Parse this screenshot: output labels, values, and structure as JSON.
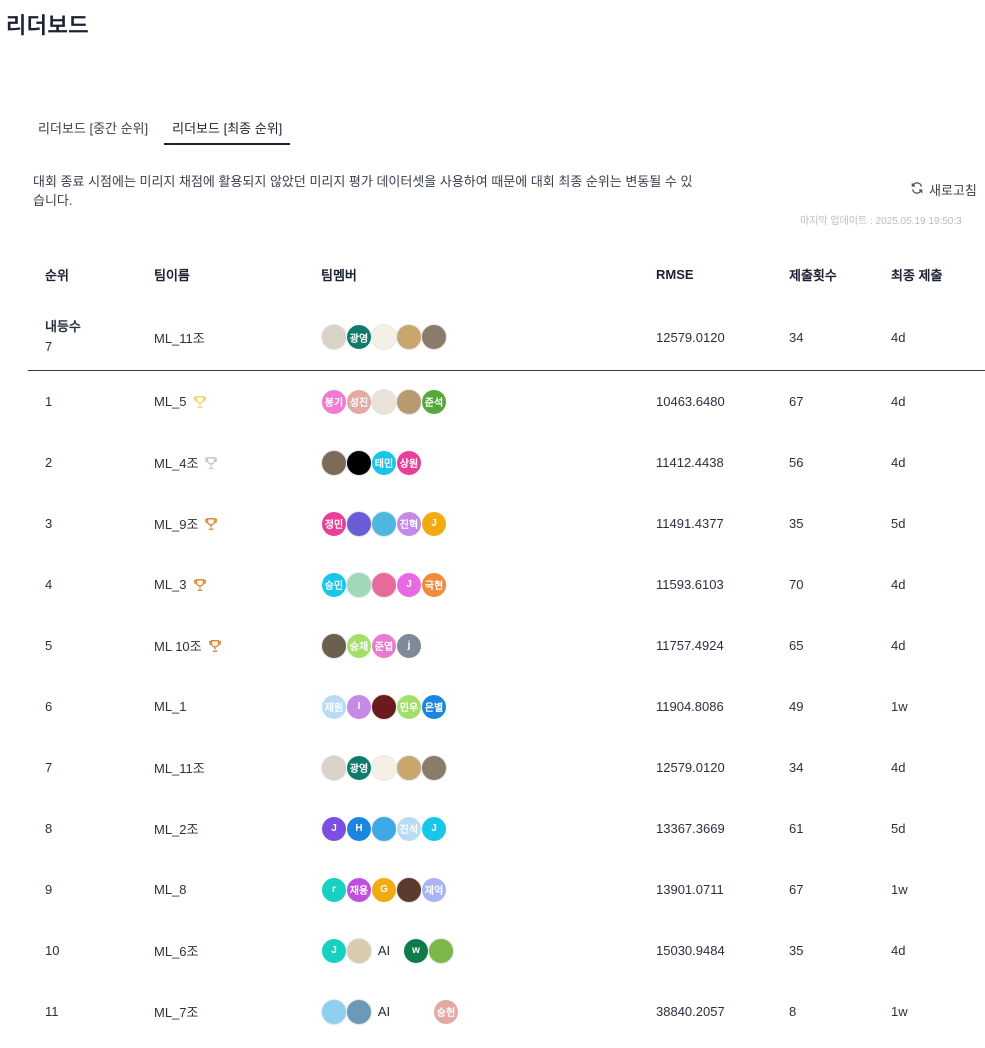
{
  "page": {
    "title": "리더보드"
  },
  "tabs": [
    {
      "label": "리더보드 [중간 순위]",
      "active": false
    },
    {
      "label": "리더보드 [최종 순위]",
      "active": true
    }
  ],
  "notice": "대회 종료 시점에는 미리지 채점에 활용되지 않았던 미리지 평가 데이터셋을 사용하여 때문에 대회 최종 순위는 변동될 수 있습니다.",
  "refresh": {
    "label": "새로고침",
    "icon": "refresh-icon"
  },
  "updated": "마지막 업데이트 : 2025.05.19 19:50:3",
  "columns": {
    "rank": "순위",
    "team": "팀이름",
    "members": "팀멤버",
    "rmse": "RMSE",
    "count": "제출횟수",
    "last": "최종 제출"
  },
  "my_team": {
    "label": "내등수",
    "rank": "7",
    "team": "ML_11조",
    "members": [
      {
        "type": "img",
        "color": "#d8d2c8"
      },
      {
        "type": "text",
        "label": "광영",
        "color": "#0f7b6c"
      },
      {
        "type": "img",
        "color": "#f4f0e6"
      },
      {
        "type": "img",
        "color": "#c9a66b"
      },
      {
        "type": "img",
        "color": "#8b7b6b"
      }
    ],
    "rmse": "12579.0120",
    "count": "34",
    "last": "4d"
  },
  "rows": [
    {
      "rank": "1",
      "team": "ML_5",
      "trophy": "gold",
      "trophy_color": "#f2d26b",
      "members": [
        {
          "type": "text",
          "label": "봉기",
          "color": "#f07bd0"
        },
        {
          "type": "text",
          "label": "성진",
          "color": "#e3a9a4"
        },
        {
          "type": "img",
          "color": "#e8e2d8"
        },
        {
          "type": "img",
          "color": "#b89a72"
        },
        {
          "type": "text",
          "label": "준석",
          "color": "#55a93a"
        }
      ],
      "rmse": "10463.6480",
      "count": "67",
      "last": "4d"
    },
    {
      "rank": "2",
      "team": "ML_4조",
      "trophy": "silver",
      "trophy_color": "#c3c7d0",
      "members": [
        {
          "type": "img",
          "color": "#7d6a58"
        },
        {
          "type": "img",
          "color": "#000000"
        },
        {
          "type": "text",
          "label": "태민",
          "color": "#18c6e8"
        },
        {
          "type": "text",
          "label": "상원",
          "color": "#e83f9a"
        }
      ],
      "rmse": "11412.4438",
      "count": "56",
      "last": "4d"
    },
    {
      "rank": "3",
      "team": "ML_9조",
      "trophy": "bronze",
      "trophy_color": "#e08a3c",
      "members": [
        {
          "type": "text",
          "label": "정민",
          "color": "#e83f9a"
        },
        {
          "type": "img",
          "color": "#6a5bd6"
        },
        {
          "type": "img",
          "color": "#4fb6e0"
        },
        {
          "type": "text",
          "label": "진혁",
          "color": "#c58ae8"
        },
        {
          "type": "text",
          "label": "J",
          "color": "#f2aa11"
        }
      ],
      "rmse": "11491.4377",
      "count": "35",
      "last": "5d"
    },
    {
      "rank": "4",
      "team": "ML_3",
      "trophy": "bronze",
      "trophy_color": "#e08a3c",
      "members": [
        {
          "type": "text",
          "label": "승민",
          "color": "#18c6e8"
        },
        {
          "type": "img",
          "color": "#9fd9b8"
        },
        {
          "type": "img",
          "color": "#e86a9a"
        },
        {
          "type": "text",
          "label": "J",
          "color": "#e86ae0"
        },
        {
          "type": "text",
          "label": "국현",
          "color": "#f08a3c"
        }
      ],
      "rmse": "11593.6103",
      "count": "70",
      "last": "4d"
    },
    {
      "rank": "5",
      "team": "ML 10조",
      "trophy": "bronze",
      "trophy_color": "#e08a3c",
      "members": [
        {
          "type": "img",
          "color": "#6b5f4e"
        },
        {
          "type": "text",
          "label": "승채",
          "color": "#a3e06b"
        },
        {
          "type": "text",
          "label": "준엽",
          "color": "#e87ad0"
        },
        {
          "type": "text",
          "label": "j",
          "color": "#7d8a99"
        }
      ],
      "rmse": "11757.4924",
      "count": "65",
      "last": "4d"
    },
    {
      "rank": "6",
      "team": "ML_1",
      "members": [
        {
          "type": "text",
          "label": "재원",
          "color": "#b8dcf4"
        },
        {
          "type": "text",
          "label": "I",
          "color": "#c58ae8"
        },
        {
          "type": "img",
          "color": "#6b1b1b"
        },
        {
          "type": "text",
          "label": "민우",
          "color": "#a3e06b"
        },
        {
          "type": "text",
          "label": "은별",
          "color": "#1a86e0"
        }
      ],
      "rmse": "11904.8086",
      "count": "49",
      "last": "1w"
    },
    {
      "rank": "7",
      "team": "ML_11조",
      "members": [
        {
          "type": "img",
          "color": "#d8d2c8"
        },
        {
          "type": "text",
          "label": "광영",
          "color": "#0f7b6c"
        },
        {
          "type": "img",
          "color": "#f4f0e6"
        },
        {
          "type": "img",
          "color": "#c9a66b"
        },
        {
          "type": "img",
          "color": "#8b7b6b"
        }
      ],
      "rmse": "12579.0120",
      "count": "34",
      "last": "4d"
    },
    {
      "rank": "8",
      "team": "ML_2조",
      "members": [
        {
          "type": "text",
          "label": "J",
          "color": "#7b4fe0"
        },
        {
          "type": "text",
          "label": "H",
          "color": "#1a86e0"
        },
        {
          "type": "img",
          "color": "#3fa9e8"
        },
        {
          "type": "text",
          "label": "진석",
          "color": "#b8dcf4"
        },
        {
          "type": "text",
          "label": "J",
          "color": "#18c6e8"
        }
      ],
      "rmse": "13367.3669",
      "count": "61",
      "last": "5d"
    },
    {
      "rank": "9",
      "team": "ML_8",
      "members": [
        {
          "type": "text",
          "label": "r",
          "color": "#18d0c0"
        },
        {
          "type": "text",
          "label": "재용",
          "color": "#c04fe0"
        },
        {
          "type": "text",
          "label": "G",
          "color": "#f2aa11"
        },
        {
          "type": "img",
          "color": "#5a3b2e"
        },
        {
          "type": "text",
          "label": "재억",
          "color": "#a9b4f4"
        }
      ],
      "rmse": "13901.0711",
      "count": "67",
      "last": "1w"
    },
    {
      "rank": "10",
      "team": "ML_6조",
      "members": [
        {
          "type": "text",
          "label": "J",
          "color": "#18d0c0"
        },
        {
          "type": "img",
          "color": "#d8ccb0"
        },
        {
          "type": "plain",
          "label": "AI"
        },
        {
          "type": "text",
          "label": "w",
          "color": "#0f7b4c"
        },
        {
          "type": "img",
          "color": "#7ab84a"
        }
      ],
      "rmse": "15030.9484",
      "count": "35",
      "last": "4d"
    },
    {
      "rank": "11",
      "team": "ML_7조",
      "members": [
        {
          "type": "img",
          "color": "#8fd0f0"
        },
        {
          "type": "img",
          "color": "#6a9ab8"
        },
        {
          "type": "plain",
          "label": "AI"
        },
        {
          "type": "space"
        },
        {
          "type": "text",
          "label": "승헌",
          "color": "#e3a9a4"
        }
      ],
      "rmse": "38840.2057",
      "count": "8",
      "last": "1w"
    }
  ]
}
